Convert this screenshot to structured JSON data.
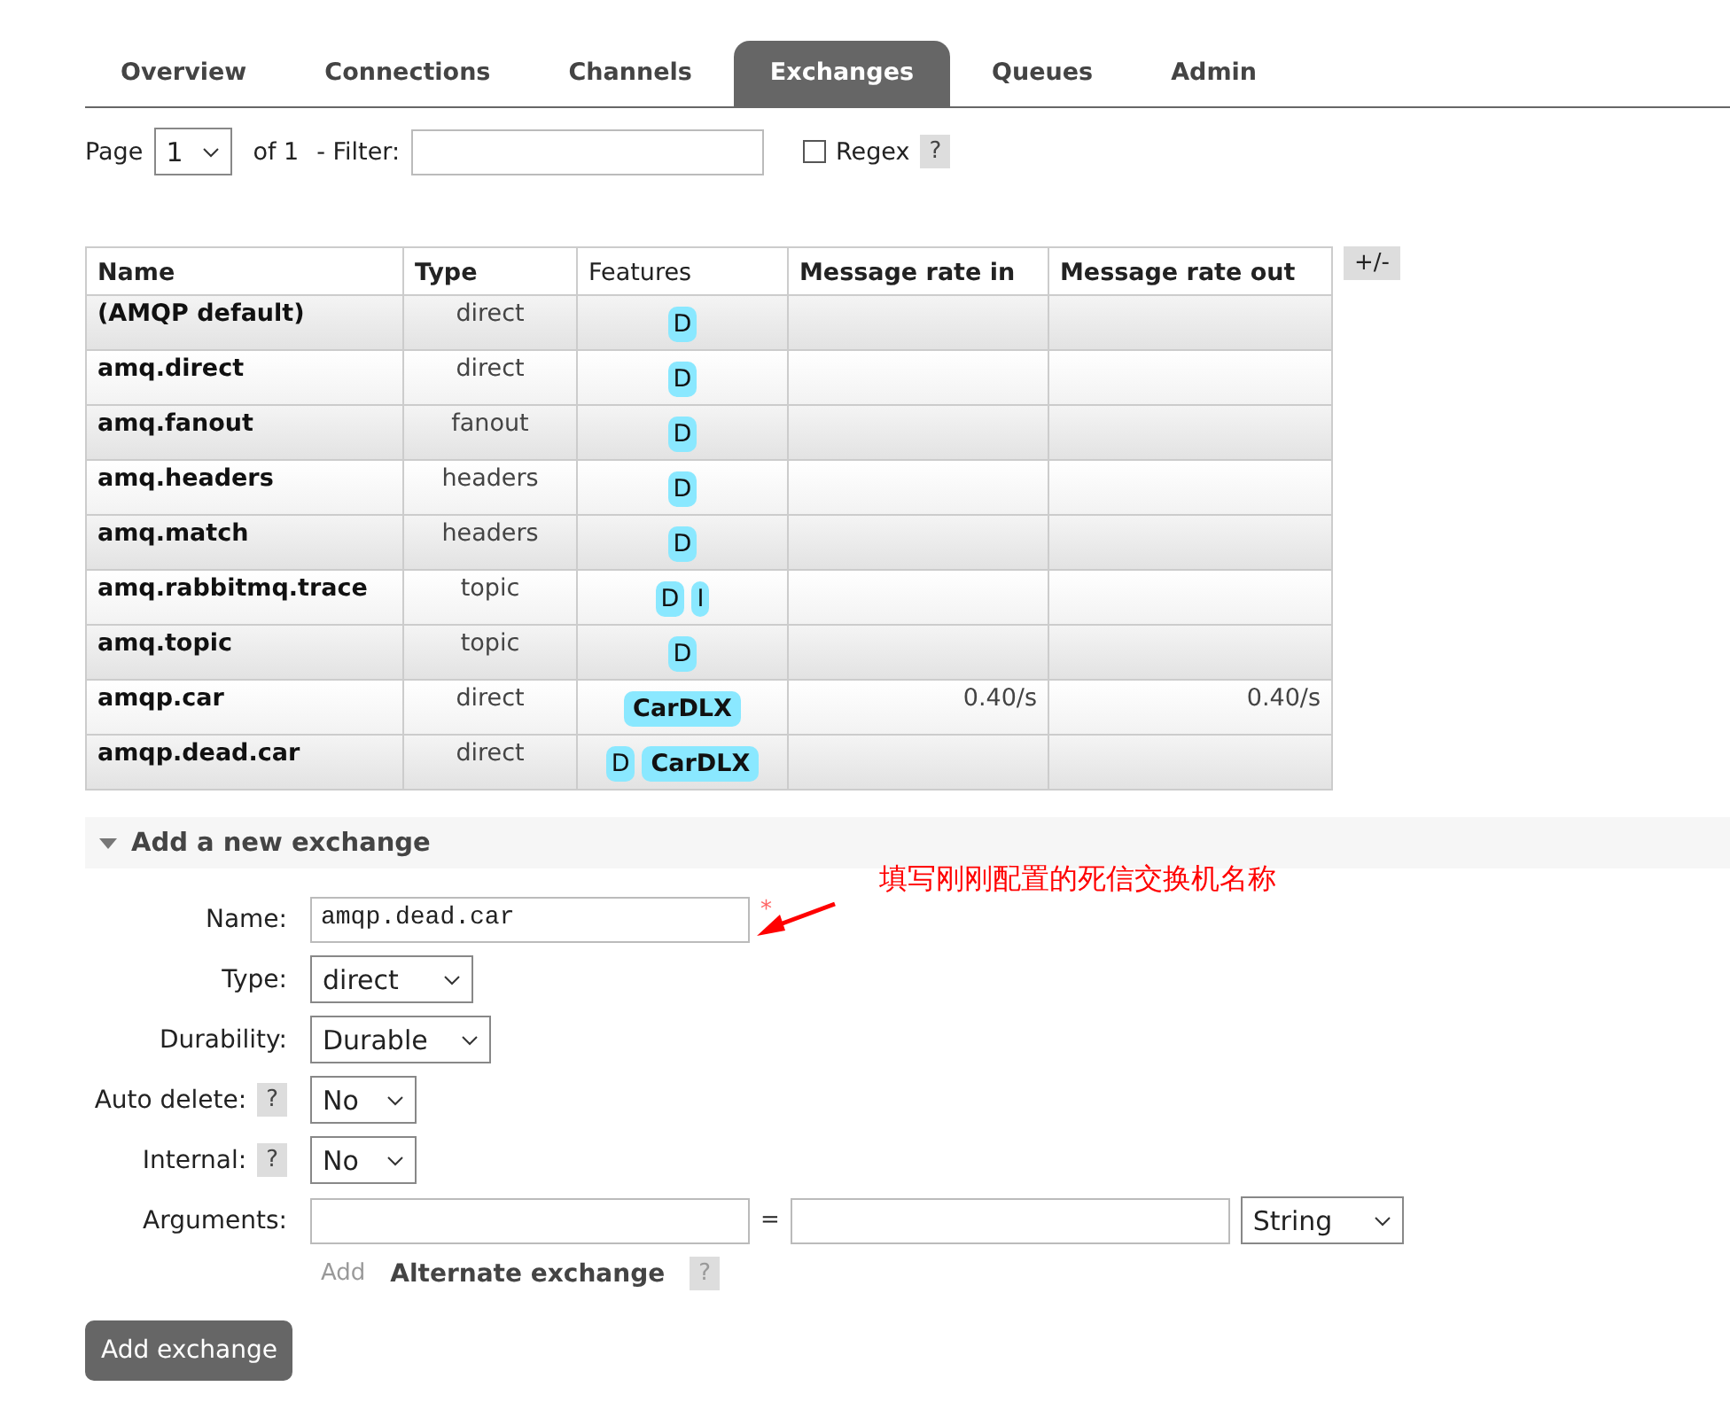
{
  "tabs": [
    {
      "label": "Overview",
      "selected": false
    },
    {
      "label": "Connections",
      "selected": false
    },
    {
      "label": "Channels",
      "selected": false
    },
    {
      "label": "Exchanges",
      "selected": true
    },
    {
      "label": "Queues",
      "selected": false
    },
    {
      "label": "Admin",
      "selected": false
    }
  ],
  "paging": {
    "page_label": "Page",
    "page": "1",
    "of": "of 1",
    "filter_label": "- Filter:",
    "regex_label": "Regex",
    "regex_checked": false,
    "help": "?"
  },
  "table": {
    "columns": [
      "Name",
      "Type",
      "Features",
      "Message rate in",
      "Message rate out"
    ],
    "toggle": "+/-",
    "rows": [
      {
        "name": "(AMQP default)",
        "type": "direct",
        "features": [
          "D"
        ],
        "rate_in": "",
        "rate_out": ""
      },
      {
        "name": "amq.direct",
        "type": "direct",
        "features": [
          "D"
        ],
        "rate_in": "",
        "rate_out": ""
      },
      {
        "name": "amq.fanout",
        "type": "fanout",
        "features": [
          "D"
        ],
        "rate_in": "",
        "rate_out": ""
      },
      {
        "name": "amq.headers",
        "type": "headers",
        "features": [
          "D"
        ],
        "rate_in": "",
        "rate_out": ""
      },
      {
        "name": "amq.match",
        "type": "headers",
        "features": [
          "D"
        ],
        "rate_in": "",
        "rate_out": ""
      },
      {
        "name": "amq.rabbitmq.trace",
        "type": "topic",
        "features": [
          "D",
          "I"
        ],
        "rate_in": "",
        "rate_out": ""
      },
      {
        "name": "amq.topic",
        "type": "topic",
        "features": [
          "D"
        ],
        "rate_in": "",
        "rate_out": ""
      },
      {
        "name": "amqp.car",
        "type": "direct",
        "features": [
          "CarDLX"
        ],
        "rate_in": "0.40/s",
        "rate_out": "0.40/s"
      },
      {
        "name": "amqp.dead.car",
        "type": "direct",
        "features": [
          "D",
          "CarDLX"
        ],
        "rate_in": "",
        "rate_out": ""
      }
    ]
  },
  "add_section": {
    "title": "Add a new exchange",
    "expanded": true,
    "name_label": "Name:",
    "name_value": "amqp.dead.car",
    "required_mark": "*",
    "annotation": "填写刚刚配置的死信交换机名称",
    "type_label": "Type:",
    "type_value": "direct",
    "durability_label": "Durability:",
    "durability_value": "Durable",
    "auto_delete_label": "Auto delete:",
    "auto_delete_value": "No",
    "internal_label": "Internal:",
    "internal_value": "No",
    "arguments_label": "Arguments:",
    "equals": "=",
    "arg_type": "String",
    "add_link": "Add",
    "alternate_label": "Alternate exchange",
    "help": "?",
    "submit": "Add exchange"
  }
}
